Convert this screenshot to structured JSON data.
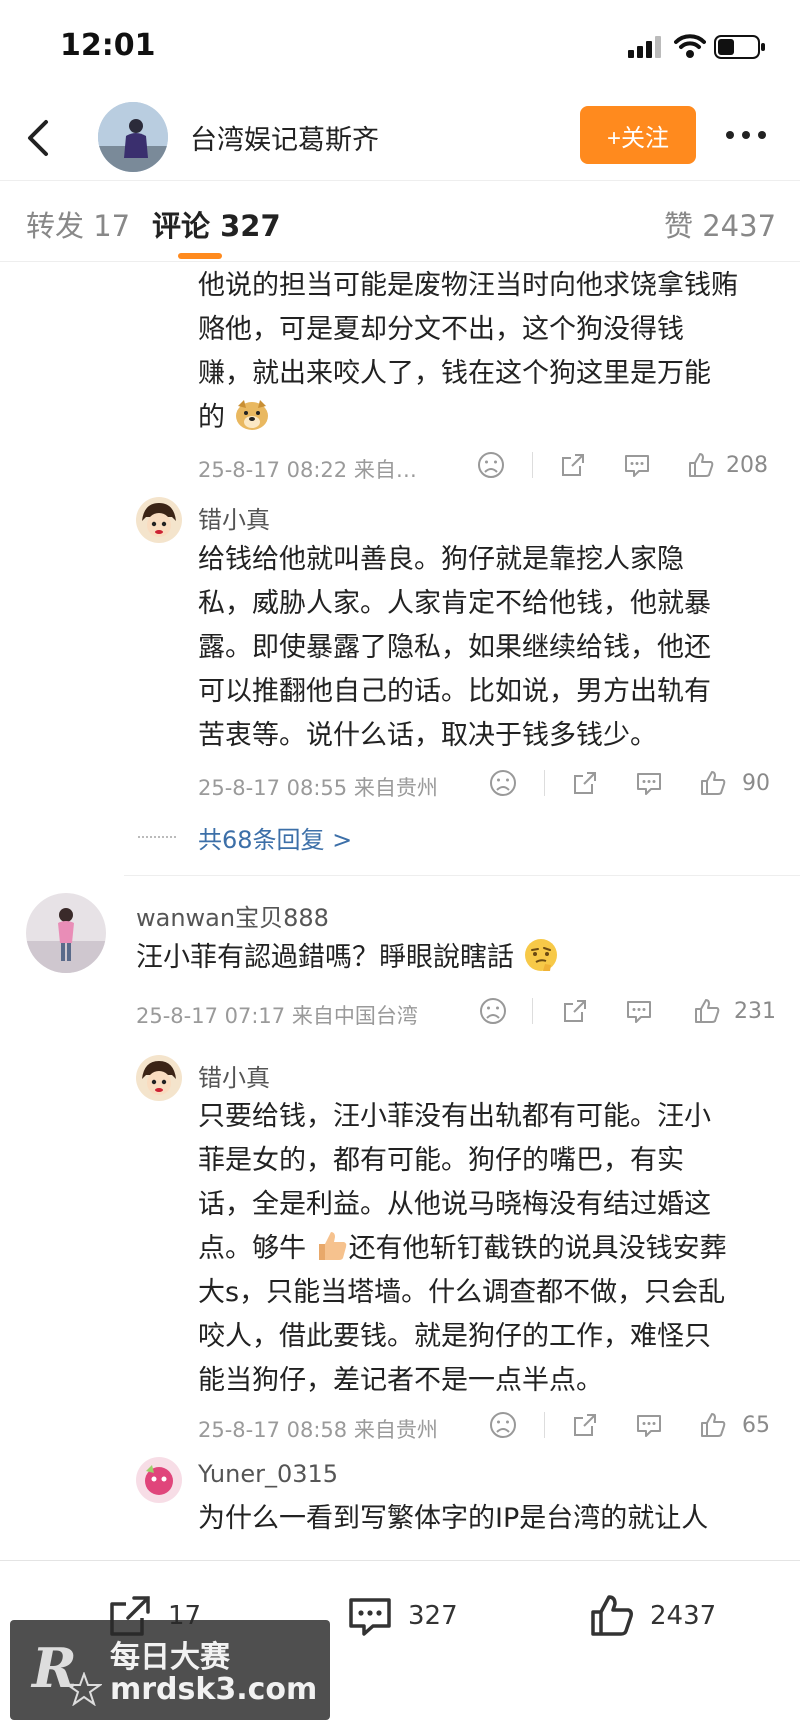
{
  "status_bar": {
    "time": "12:01"
  },
  "header": {
    "name": "台湾娱记葛斯齐",
    "follow_label": "+关注"
  },
  "tabs": [
    {
      "label": "转发 17"
    },
    {
      "label": "评论 327"
    },
    {
      "label": "赞 2437"
    }
  ],
  "comments": [
    {
      "text_lines": [
        "他说的担当可能是废物汪当时向他求饶拿钱贿",
        "赂他，可是夏却分文不出，这个狗没得钱",
        "赚，就出来咬人了，钱在这个狗这里是万能",
        "的"
      ],
      "time": "25-8-17 08:22 来自…",
      "likes": "208"
    },
    {
      "user": "错小真",
      "text_lines": [
        "给钱给他就叫善良。狗仔就是靠挖人家隐",
        "私，威胁人家。人家肯定不给他钱，他就暴",
        "露。即使暴露了隐私，如果继续给钱，他还",
        "可以推翻他自己的话。比如说，男方出轨有",
        "苦衷等。说什么话，取决于钱多钱少。"
      ],
      "time": "25-8-17 08:55 来自贵州",
      "likes": "90"
    },
    {
      "user": "wanwan宝贝888",
      "text_lines": [
        "汪小菲有認過錯嗎？睜眼說瞎話"
      ],
      "time": "25-8-17 07:17 来自中国台湾",
      "likes": "231"
    },
    {
      "user": "错小真",
      "text_lines": [
        "只要给钱，汪小菲没有出轨都有可能。汪小",
        "菲是女的，都有可能。狗仔的嘴巴，有实",
        "话，全是利益。从他说马晓梅没有结过婚这",
        "点。够牛",
        "大s，只能当塔墙。什么调查都不做，只会乱",
        "咬人，借此要钱。就是狗仔的工作，难怪只",
        "能当狗仔，差记者不是一点半点。"
      ],
      "line4_tail": "还有他斩钉截铁的说具没钱安葬",
      "time": "25-8-17 08:58 来自贵州",
      "likes": "65"
    },
    {
      "user": "Yuner_0315",
      "text_lines": [
        "为什么一看到写繁体字的IP是台湾的就让人"
      ]
    }
  ],
  "more_replies": "共68条回复 >",
  "bottom_bar": {
    "repost": "17",
    "comment": "327",
    "like": "2437"
  },
  "watermark": {
    "logo": "R",
    "line1": "每日大赛",
    "line2": "mrdsk3.com"
  }
}
